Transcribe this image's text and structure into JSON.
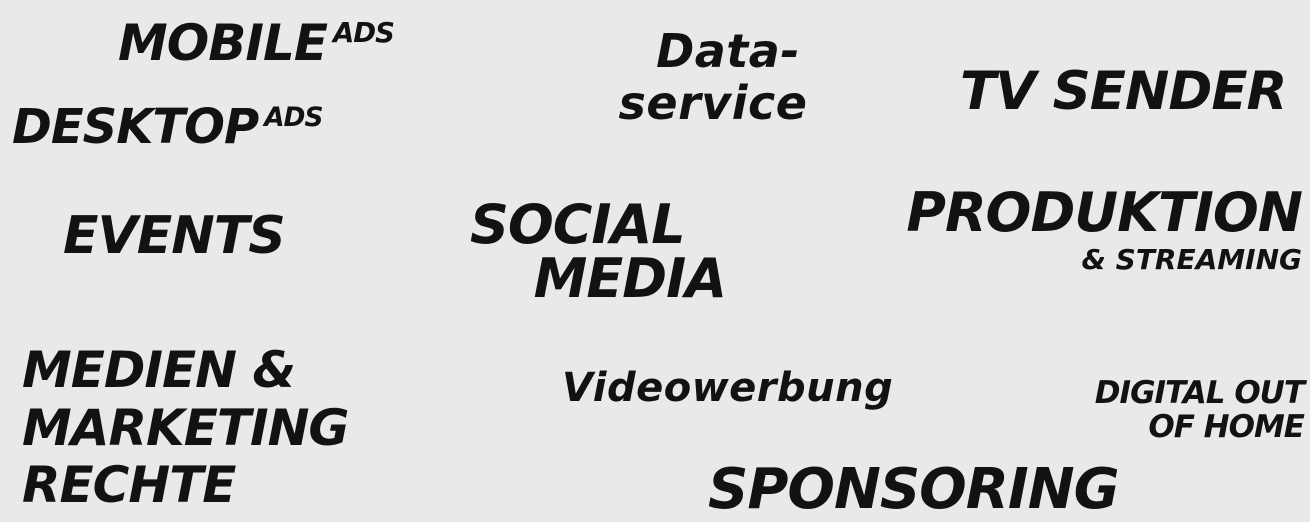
{
  "items": {
    "mobile_ads": {
      "main": "MOBILE",
      "suffix": "ADS"
    },
    "desktop_ads": {
      "main": "DESKTOP",
      "suffix": "ADS"
    },
    "dataservice": {
      "line1": "Data-",
      "line2": "service"
    },
    "tv_sender": {
      "text": "TV SENDER"
    },
    "events": {
      "text": "EVENTS"
    },
    "social_media": {
      "line1": "SOCIAL",
      "line2": "MEDIA"
    },
    "produktion": {
      "main": "PRODUKTION",
      "sub": "& STREAMING"
    },
    "medien_marketing": {
      "line1": "MEDIEN &",
      "line2": "MARKETING",
      "line3": "RECHTE"
    },
    "videowerbung": {
      "text": "Videowerbung"
    },
    "digital_out_of_home": {
      "line1": "DIGITAL OUT",
      "line2": "OF HOME"
    },
    "sponsoring": {
      "text": "SPONSORING"
    }
  }
}
